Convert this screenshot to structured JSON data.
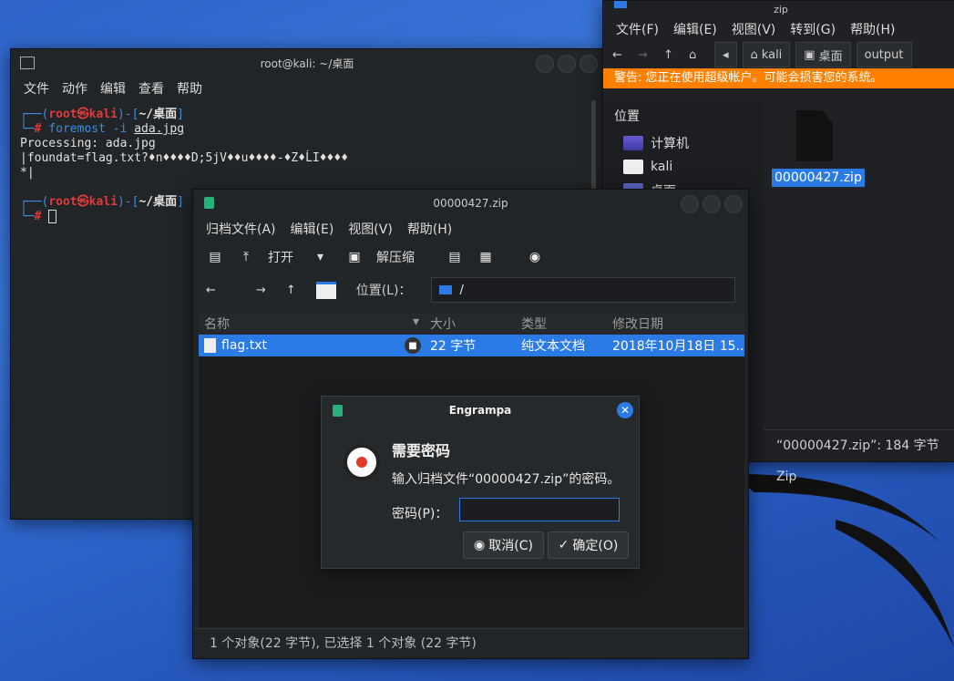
{
  "terminal": {
    "title": "root@kali: ~/桌面",
    "menu": [
      "文件",
      "动作",
      "编辑",
      "查看",
      "帮助"
    ],
    "prompt1": {
      "user": "root",
      "host": "kali",
      "path": "~/桌面",
      "cmd": "foremost -i ",
      "arg": "ada.jpg"
    },
    "output": [
      "Processing: ada.jpg",
      "|foundat=flag.txt?♦n♦♦♦♦D;5jV♦♦u♦♦♦♦-♦Z♦ĹI♦♦♦♦",
      "*|"
    ],
    "prompt2": {
      "user": "root",
      "host": "kali",
      "path": "~/桌面"
    }
  },
  "file_manager": {
    "title": "zip",
    "menu": [
      "文件(F)",
      "编辑(E)",
      "视图(V)",
      "转到(G)",
      "帮助(H)"
    ],
    "crumbs": [
      "kali",
      "桌面",
      "output"
    ],
    "warning": "警告: 您正在使用超级帐户。可能会损害您的系统。",
    "sidebar_title": "位置",
    "sidebar_items": [
      "计算机",
      "kali",
      "桌面"
    ],
    "selected_file": "00000427.zip",
    "status": "“00000427.zip”: 184 字节 Zip"
  },
  "archive": {
    "title": "00000427.zip",
    "menu": [
      "归档文件(A)",
      "编辑(E)",
      "视图(V)",
      "帮助(H)"
    ],
    "open_label": "打开",
    "extract_label": "解压缩",
    "location_label": "位置(L)：",
    "location_value": "/",
    "columns": [
      "名称",
      "大小",
      "类型",
      "修改日期"
    ],
    "row": {
      "name": "flag.txt",
      "size": "22 字节",
      "type": "纯文本文档",
      "date": "2018年10月18日 15..."
    },
    "status": "1 个对象(22 字节), 已选择 1 个对象 (22 字节)"
  },
  "dialog": {
    "title": "Engrampa",
    "heading": "需要密码",
    "message": "输入归档文件“00000427.zip”的密码。",
    "password_label": "密码(P)：",
    "cancel": "取消(C)",
    "ok": "确定(O)"
  }
}
